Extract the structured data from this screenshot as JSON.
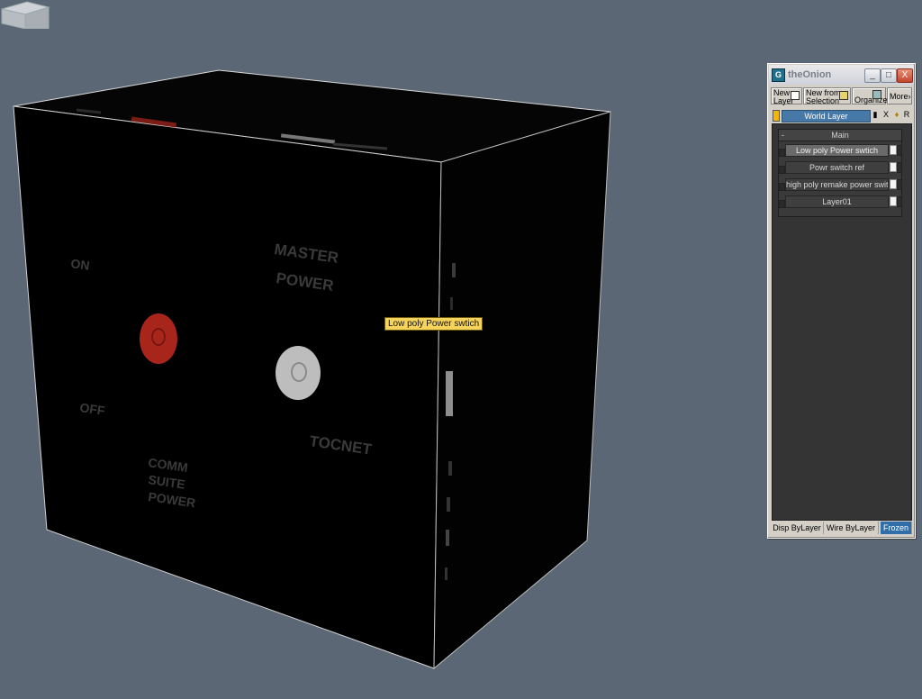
{
  "viewport": {
    "tooltip": "Low poly Power swtich",
    "box_labels": {
      "on": "ON",
      "off": "OFF",
      "master": "MASTER",
      "power": "POWER",
      "comm": "COMM",
      "suite": "SUITE",
      "comm_power": "POWER",
      "tocnet": "TOCNET"
    }
  },
  "colors": {
    "viewport_bg": "#5c6775",
    "red_button": "#a8251c",
    "white_button": "#bdbdbd",
    "accent_blue": "#4678a8",
    "layer_color": "#f2b705"
  },
  "window": {
    "title": "theOnion",
    "icon_letter": "G",
    "controls": {
      "minimize": "_",
      "maximize": "□",
      "close": "X"
    },
    "toolbar": {
      "new_layer_1": "New",
      "new_layer_2": "Layer",
      "new_from_1": "New from",
      "new_from_2": "Selection",
      "organize": "Organize",
      "more": "More",
      "more_arrow": "›"
    },
    "world_layer": {
      "name": "World Layer",
      "icons": [
        "▮",
        "X",
        "♦",
        "R"
      ]
    },
    "group": {
      "collapse": "-",
      "name": "Main",
      "layers": [
        {
          "name": "Low poly Power swtich"
        },
        {
          "name": "Powr switch ref"
        },
        {
          "name": "high poly remake power switch"
        },
        {
          "name": "Layer01"
        }
      ]
    },
    "bottom": {
      "disp": "Disp ByLayer",
      "wire": "Wire ByLayer",
      "frozen": "Frozen"
    }
  }
}
